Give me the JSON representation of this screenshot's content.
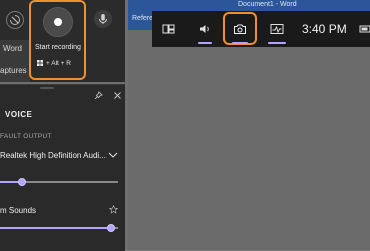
{
  "word": {
    "title": "Document1  -  Word",
    "ribbon_tab": "Referen"
  },
  "capture_widget": {
    "left_label_word": "Word",
    "left_label_captures": "aptures",
    "start_recording_label": "Start recording",
    "shortcut_label": "+ Alt + R"
  },
  "audio_panel": {
    "title": "VOICE",
    "default_output_label": "FAULT OUTPUT",
    "output_device": "Realtek High Definition Audi...",
    "master_volume": 0.19,
    "app_name": "m Sounds",
    "app_volume": 0.94
  },
  "gamebar": {
    "time": "3:40 PM",
    "accent_color": "#b4a4ff",
    "highlight_color": "#f0902c"
  }
}
